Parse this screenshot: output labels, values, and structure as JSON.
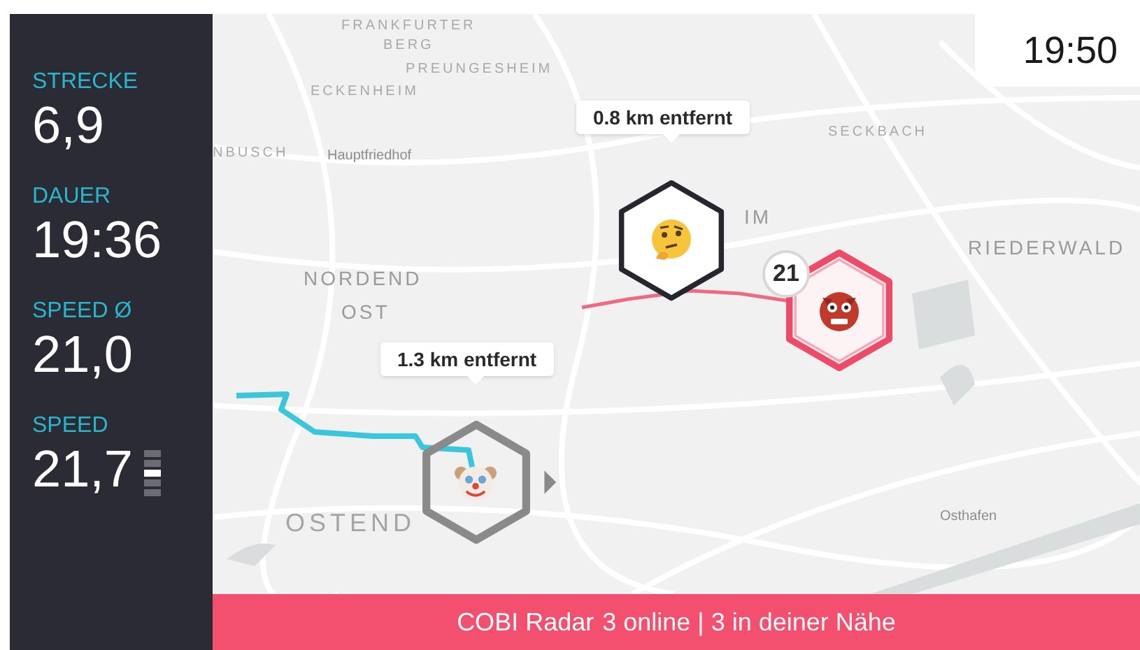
{
  "metrics": [
    {
      "label": "STRECKE",
      "value": "6,9"
    },
    {
      "label": "DAUER",
      "value": "19:36"
    },
    {
      "label": "SPEED Ø",
      "value": "21,0"
    },
    {
      "label": "SPEED",
      "value": "21,7"
    }
  ],
  "speed_indicator": [
    {
      "selected": false
    },
    {
      "selected": false
    },
    {
      "selected": true
    },
    {
      "selected": false
    },
    {
      "selected": false
    }
  ],
  "clock": "19:50",
  "map_labels": [
    {
      "text": "FRANKFURTER",
      "kind": "small"
    },
    {
      "text": "BERG",
      "kind": "small"
    },
    {
      "text": "PREUNGESHEIM",
      "kind": "small"
    },
    {
      "text": "ECKENHEIM",
      "kind": "small"
    },
    {
      "text": "NBUSCH",
      "kind": "small"
    },
    {
      "text": "Hauptfriedhof",
      "kind": "place"
    },
    {
      "text": "SECKBACH",
      "kind": "small"
    },
    {
      "text": "IM",
      "kind": "medium"
    },
    {
      "text": "RIEDERWALD",
      "kind": "medium"
    },
    {
      "text": "NORDEND",
      "kind": "medium"
    },
    {
      "text": "OST",
      "kind": "medium"
    },
    {
      "text": "OSTEND",
      "kind": "large"
    },
    {
      "text": "Osthafen",
      "kind": "place"
    }
  ],
  "riders": [
    {
      "kind": "friend",
      "distance": "0.8 km entfernt"
    },
    {
      "kind": "rival",
      "badge": "21"
    },
    {
      "kind": "self",
      "distance": "1.3 km entfernt"
    }
  ],
  "status_bar": {
    "brand": "COBI Radar",
    "text": "3 online | 3 in deiner Nähe"
  }
}
